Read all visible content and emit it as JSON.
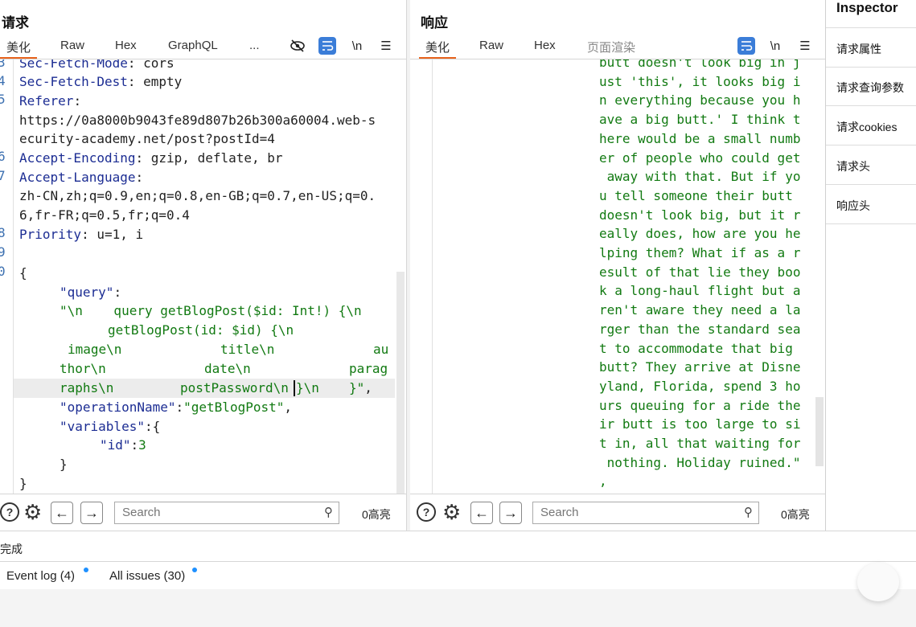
{
  "request": {
    "title": "请求",
    "tabs": [
      "美化",
      "Raw",
      "Hex",
      "GraphQL",
      "..."
    ],
    "toolbar": {
      "newline_label": "\\n",
      "menu_label": "☰"
    },
    "line_numbers": [
      "3",
      "4",
      "5",
      "6",
      "7",
      "8",
      "9",
      "0"
    ],
    "lines": [
      {
        "k": "Sec-Fetch-Mode",
        "v": ": cors"
      },
      {
        "k": "Sec-Fetch-Dest",
        "v": ": empty"
      },
      {
        "k": "Referer",
        "v": ":"
      },
      {
        "t": "https://0a8000b9043fe89d807b26b300a60004.web-s"
      },
      {
        "t": "ecurity-academy.net/post?postId=4"
      },
      {
        "k": "Accept-Encoding",
        "v": ": gzip, deflate, br"
      },
      {
        "k": "Accept-Language",
        "v": ":"
      },
      {
        "t": "zh-CN,zh;q=0.9,en;q=0.8,en-GB;q=0.7,en-US;q=0."
      },
      {
        "t": "6,fr-FR;q=0.5,fr;q=0.4"
      },
      {
        "k": "Priority",
        "v": ": u=1, i"
      }
    ],
    "json_body": {
      "open": "{",
      "query_key": "\"query\"",
      "colon": ":",
      "query_l1": "\"\\n    query getBlogPost($id: Int!) {\\n",
      "query_l2": "getBlogPost(id: $id) {\\n",
      "query_l3a": "image\\n",
      "query_l3b": "title\\n",
      "query_l3c": "au",
      "query_l4a": "thor\\n",
      "query_l4b": "date\\n",
      "query_l4c": "parag",
      "query_l5a": "raphs\\n",
      "query_l5b": "postPassword\\n",
      "query_l5c": "}\\n",
      "query_l5d": "}\"",
      "comma": ",",
      "op_key": "\"operationName\"",
      "op_val": "\"getBlogPost\"",
      "vars_key": "\"variables\"",
      "vars_open": "{",
      "id_key": "\"id\"",
      "id_val": "3",
      "vars_close": "}",
      "close": "}"
    },
    "search": {
      "placeholder": "Search",
      "highlights": "0高亮"
    }
  },
  "response": {
    "title": "响应",
    "tabs": [
      "美化",
      "Raw",
      "Hex",
      "页面渲染"
    ],
    "toolbar": {
      "newline_label": "\\n",
      "menu_label": "☰"
    },
    "lines": [
      "butt doesn't look big in j",
      "ust 'this', it looks big i",
      "n everything because you h",
      "ave a big butt.' I think t",
      "here would be a small numb",
      "er of people who could get",
      " away with that. But if yo",
      "u tell someone their butt ",
      "doesn't look big, but it r",
      "eally does, how are you he",
      "lping them? What if as a r",
      "esult of that lie they boo",
      "k a long-haul flight but a",
      "ren't aware they need a la",
      "rger than the standard sea",
      "t to accommodate that big ",
      "butt? They arrive at Disne",
      "yland, Florida, spend 3 ho",
      "urs queuing for a ride the",
      "ir butt is too large to si",
      "t in, all that waiting for",
      " nothing. Holiday ruined.\"",
      ","
    ],
    "search": {
      "placeholder": "Search",
      "highlights": "0高亮"
    }
  },
  "inspector": {
    "title": "Inspector",
    "items": [
      "请求属性",
      "请求查询参数",
      "请求cookies",
      "请求头",
      "响应头"
    ]
  },
  "status": {
    "text": "完成"
  },
  "issues": {
    "event_log": "Event log (4)",
    "all_issues": "All issues (30)"
  },
  "colors": {
    "accent": "#e8631c",
    "blue_button": "#3b7dd8",
    "header_name": "#1c2d93",
    "string": "#127a12",
    "notification_dot": "#1e90ff"
  }
}
